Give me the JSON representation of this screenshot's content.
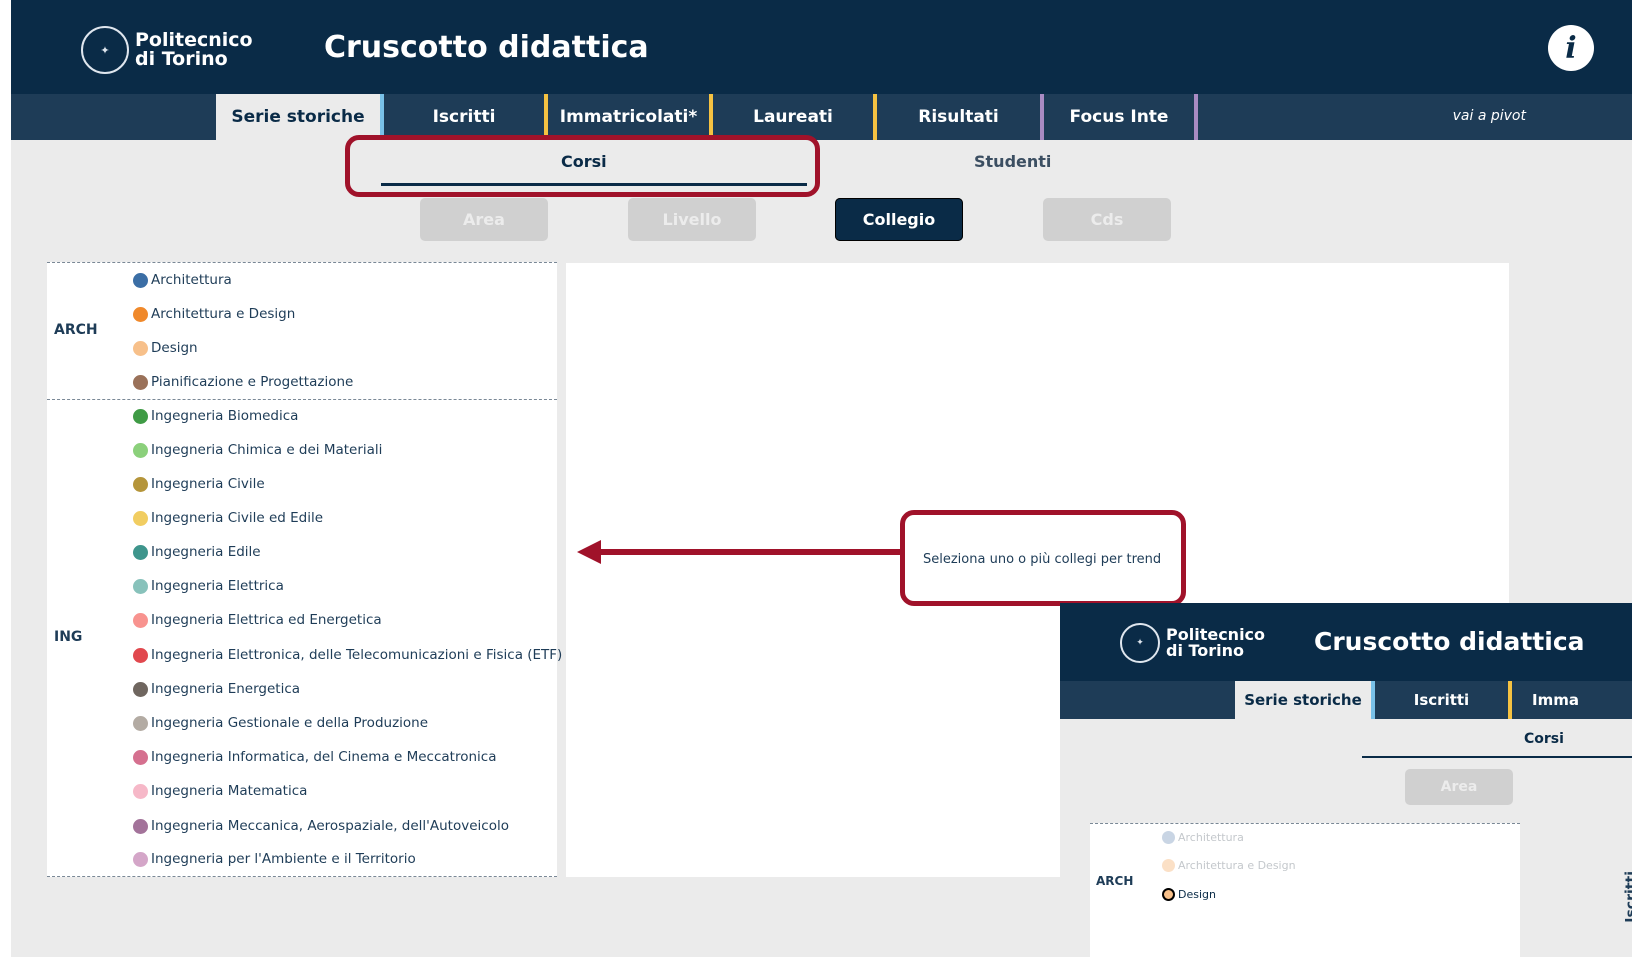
{
  "header": {
    "logo_line1": "Politecnico",
    "logo_line2": "di Torino",
    "title": "Cruscotto didattica",
    "info_icon": "i"
  },
  "tabs": [
    {
      "label": "Serie storiche",
      "active": true
    },
    {
      "label": "Iscritti"
    },
    {
      "label": "Immatricolati*"
    },
    {
      "label": "Laureati"
    },
    {
      "label": "Risultati"
    },
    {
      "label": "Focus Inte"
    }
  ],
  "tab_separator_colors": [
    "#79c1e8",
    "#f5c242",
    "#f5c242",
    "#f5c242",
    "#a98bc3",
    "#a98bc3"
  ],
  "pivot_link": "vai a pivot",
  "subtabs": {
    "corsi": "Corsi",
    "studenti": "Studenti"
  },
  "filters": {
    "area": "Area",
    "livello": "Livello",
    "collegio": "Collegio",
    "cds": "Cds"
  },
  "legend": {
    "groups": [
      {
        "label": "ARCH"
      },
      {
        "label": "ING"
      }
    ],
    "items": [
      {
        "label": "Architettura",
        "color": "#3b6ea5"
      },
      {
        "label": "Architettura e Design",
        "color": "#f0892b"
      },
      {
        "label": "Design",
        "color": "#f7c08a"
      },
      {
        "label": "Pianificazione e Progettazione",
        "color": "#9a7159"
      },
      {
        "label": "Ingegneria Biomedica",
        "color": "#3f9b45"
      },
      {
        "label": "Ingegneria Chimica e dei Materiali",
        "color": "#8bd07b"
      },
      {
        "label": "Ingegneria Civile",
        "color": "#b5953a"
      },
      {
        "label": "Ingegneria Civile ed Edile",
        "color": "#f1cd61"
      },
      {
        "label": "Ingegneria Edile",
        "color": "#3e958c"
      },
      {
        "label": "Ingegneria Elettrica",
        "color": "#88c2bb"
      },
      {
        "label": "Ingegneria Elettrica ed Energetica",
        "color": "#f8938f"
      },
      {
        "label": "Ingegneria Elettronica, delle Telecomunicazioni e Fisica (ETF)",
        "color": "#e1484e"
      },
      {
        "label": "Ingegneria Energetica",
        "color": "#6f665f"
      },
      {
        "label": "Ingegneria Gestionale e della Produzione",
        "color": "#b3aba3"
      },
      {
        "label": "Ingegneria Informatica, del Cinema e Meccatronica",
        "color": "#d5708f"
      },
      {
        "label": "Ingegneria Matematica",
        "color": "#f6b8c8"
      },
      {
        "label": "Ingegneria Meccanica, Aerospaziale, dell'Autoveicolo",
        "color": "#a3739a"
      },
      {
        "label": "Ingegneria per l'Ambiente e il Territorio",
        "color": "#d4a6c8"
      }
    ]
  },
  "chart_message": "Seleziona uno o più collegi per trend",
  "annotation_color": "#a0122a",
  "inset": {
    "logo_line1": "Politecnico",
    "logo_line2": "di Torino",
    "title": "Cruscotto didattica",
    "tabs": [
      "Serie storiche",
      "Iscritti",
      "Imma"
    ],
    "subtab": "Corsi",
    "filter": "Area",
    "group": "ARCH",
    "items": [
      "Architettura",
      "Architettura e Design",
      "Design"
    ],
    "vertical_label": "Iscritti"
  }
}
